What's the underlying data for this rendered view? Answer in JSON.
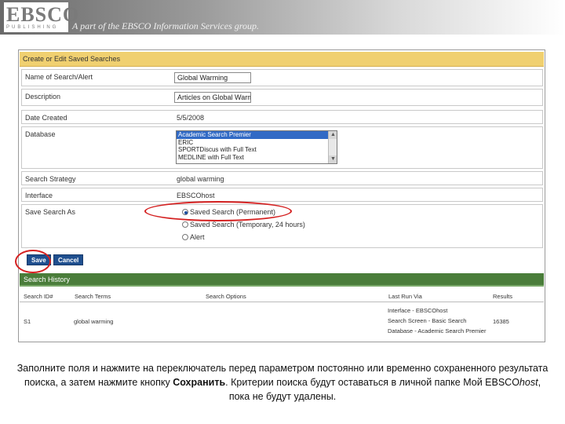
{
  "banner": {
    "logo_text": "EBSCO",
    "logo_sub": "PUBLISHING",
    "tagline": "A part of the EBSCO Information Services group."
  },
  "form": {
    "header": "Create or Edit Saved Searches",
    "fields": {
      "name_label": "Name of Search/Alert",
      "name_value": "Global Warming",
      "description_label": "Description",
      "description_value": "Articles on Global Warming",
      "date_label": "Date Created",
      "date_value": "5/5/2008",
      "database_label": "Database",
      "database_options": [
        "Academic Search Premier",
        "ERIC",
        "SPORTDiscus with Full Text",
        "MEDLINE with Full Text"
      ],
      "database_selected_index": 0,
      "strategy_label": "Search Strategy",
      "strategy_value": "global warming",
      "interface_label": "Interface",
      "interface_value": "EBSCOhost",
      "save_as_label": "Save Search As",
      "save_as_options": [
        "Saved Search (Permanent)",
        "Saved Search (Temporary, 24 hours)",
        "Alert"
      ],
      "save_as_selected_index": 0
    },
    "buttons": {
      "save": "Save",
      "cancel": "Cancel"
    }
  },
  "history": {
    "title": "Search History",
    "columns": [
      "Search ID#",
      "Search Terms",
      "Search Options",
      "Last Run Via",
      "Results"
    ],
    "rows": [
      {
        "id": "S1",
        "terms": "global warming",
        "options": "",
        "last_run": [
          "Interface - EBSCOhost",
          "Search Screen - Basic Search",
          "Database - Academic Search Premier"
        ],
        "results": "16385"
      }
    ]
  },
  "caption": {
    "part1": "Заполните поля и нажмите на переключатель перед параметром постоянно или временно сохраненного результата поиска, а затем нажмите кнопку ",
    "bold": "Сохранить",
    "part2": ". Критерии поиска будут оставаться в личной папке Мой EBSCO",
    "italic": "host",
    "part3": ", пока не будут удалены."
  },
  "colors": {
    "highlight_ring": "#d42020",
    "form_header": "#f0d070",
    "history_header": "#4a7d3a",
    "button": "#1f4f8f"
  }
}
